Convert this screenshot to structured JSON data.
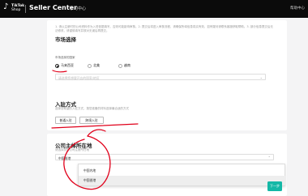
{
  "header": {
    "logo_tiktok": "TikTok",
    "logo_shop": "Shop",
    "seller_center": "Seller Center",
    "learning_center": "学习中心",
    "help": "帮助中心"
  },
  "market": {
    "notice": "1. 请以注册时的公司资料作为入驻依据填写，否则可能影响审核。2. 提交后将进入审核流程，请确保所填信息真实有效，如有疑问请联系客服获取帮助。3. 部分信息提交后无法修改，请谨慎填写并核对无误后再提交。",
    "title": "市场选择",
    "field_label": "市场选择的国家",
    "options": [
      "马来西亚",
      "北美",
      "越南"
    ],
    "selected": "马来西亚",
    "select_placeholder": "请选择您想要开店的国家/地区"
  },
  "entry": {
    "title": "入驻方式",
    "desc": "选择您希望的入驻方式，按您准备的材料选择最合适的方式",
    "options": [
      "普通入驻",
      "跨境入驻"
    ]
  },
  "company": {
    "title": "公司主体所在地",
    "desc": "请选择您的公司注册所在地",
    "select_value": "中国香港",
    "dropdown_options": [
      "中国内地",
      "中国香港"
    ],
    "highlighted": "中国香港"
  },
  "footer": {
    "next_label": "下一步"
  },
  "colors": {
    "accent": "#14b8a6",
    "annotation": "#e0001a"
  }
}
